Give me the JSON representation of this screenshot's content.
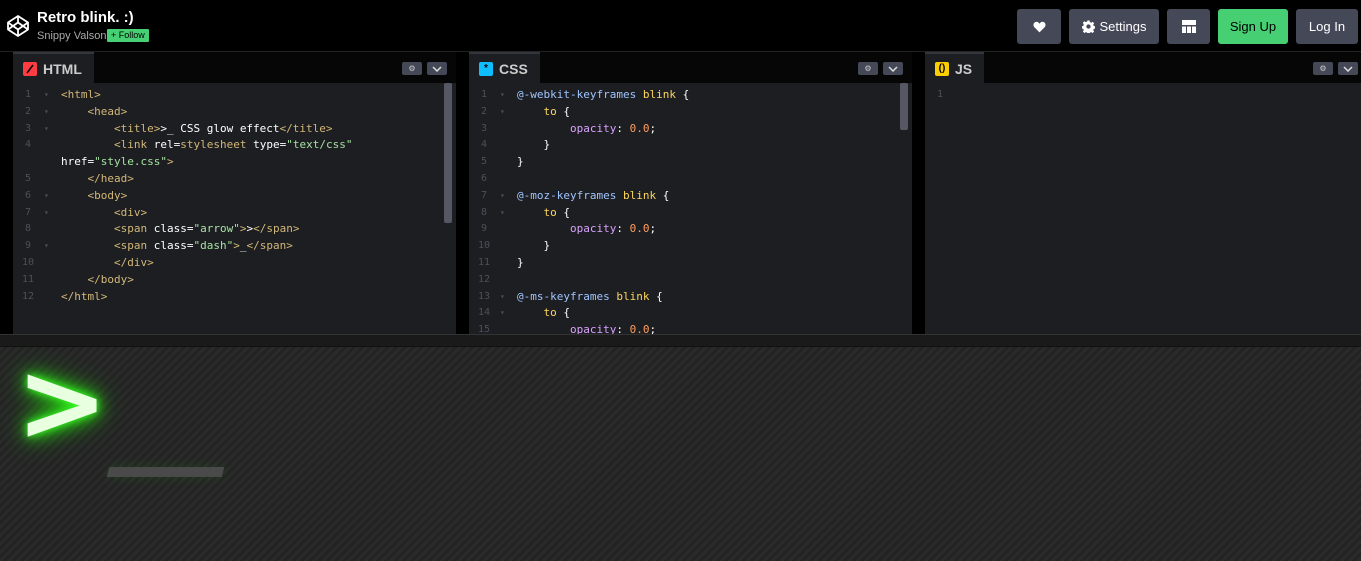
{
  "header": {
    "title": "Retro blink. :)",
    "author": "Snippy Valson",
    "follow_label": "+ Follow",
    "buttons": {
      "settings": "Settings",
      "signup": "Sign Up",
      "login": "Log In"
    }
  },
  "panes": {
    "html": {
      "label": "HTML",
      "icon": "html-icon",
      "color": "#ff3c41"
    },
    "css": {
      "label": "CSS",
      "icon": "css-icon",
      "color": "#0ebeff"
    },
    "js": {
      "label": "JS",
      "icon": "js-icon",
      "color": "#fcd000"
    }
  },
  "html_code": [
    {
      "n": "1",
      "fold": true,
      "parts": [
        [
          "tag",
          "<html>"
        ]
      ]
    },
    {
      "n": "2",
      "fold": true,
      "parts": [
        [
          "plain",
          "    "
        ],
        [
          "tag",
          "<head>"
        ]
      ]
    },
    {
      "n": "3",
      "fold": true,
      "parts": [
        [
          "plain",
          "        "
        ],
        [
          "tag",
          "<title>"
        ],
        [
          "plain",
          ">_ CSS glow effect"
        ],
        [
          "tag",
          "</title>"
        ]
      ]
    },
    {
      "n": "4",
      "fold": false,
      "parts": [
        [
          "plain",
          "        "
        ],
        [
          "tag",
          "<link "
        ],
        [
          "attr",
          "rel"
        ],
        [
          "plain",
          "="
        ],
        [
          "tag",
          "stylesheet "
        ],
        [
          "attr",
          "type"
        ],
        [
          "plain",
          "="
        ],
        [
          "str",
          "\"text/css\""
        ]
      ]
    },
    {
      "n": "",
      "fold": false,
      "parts": [
        [
          "attr",
          "href"
        ],
        [
          "plain",
          "="
        ],
        [
          "str",
          "\"style.css\""
        ],
        [
          "tag",
          ">"
        ]
      ]
    },
    {
      "n": "5",
      "fold": false,
      "parts": [
        [
          "plain",
          "    "
        ],
        [
          "tag",
          "</head>"
        ]
      ]
    },
    {
      "n": "6",
      "fold": true,
      "parts": [
        [
          "plain",
          "    "
        ],
        [
          "tag",
          "<body>"
        ]
      ]
    },
    {
      "n": "7",
      "fold": true,
      "parts": [
        [
          "plain",
          "        "
        ],
        [
          "tag",
          "<div>"
        ]
      ]
    },
    {
      "n": "8",
      "fold": false,
      "parts": [
        [
          "plain",
          "        "
        ],
        [
          "tag",
          "<span "
        ],
        [
          "attr",
          "class"
        ],
        [
          "plain",
          "="
        ],
        [
          "str",
          "\"arrow\""
        ],
        [
          "tag",
          ">"
        ],
        [
          "plain",
          ">"
        ],
        [
          "tag",
          "</span>"
        ]
      ]
    },
    {
      "n": "9",
      "fold": true,
      "parts": [
        [
          "plain",
          "        "
        ],
        [
          "tag",
          "<span "
        ],
        [
          "attr",
          "class"
        ],
        [
          "plain",
          "="
        ],
        [
          "str",
          "\"dash\""
        ],
        [
          "tag",
          ">"
        ],
        [
          "plain",
          "_"
        ],
        [
          "tag",
          "</span>"
        ]
      ]
    },
    {
      "n": "10",
      "fold": false,
      "parts": [
        [
          "plain",
          "        "
        ],
        [
          "tag",
          "</div>"
        ]
      ]
    },
    {
      "n": "11",
      "fold": false,
      "parts": [
        [
          "plain",
          "    "
        ],
        [
          "tag",
          "</body>"
        ]
      ]
    },
    {
      "n": "12",
      "fold": false,
      "parts": [
        [
          "tag",
          "</html>"
        ]
      ]
    }
  ],
  "css_code": [
    {
      "n": "1",
      "fold": true,
      "parts": [
        [
          "kw",
          "@-webkit-keyframes "
        ],
        [
          "sel",
          "blink"
        ],
        [
          "plain",
          " {"
        ]
      ]
    },
    {
      "n": "2",
      "fold": true,
      "parts": [
        [
          "plain",
          "    "
        ],
        [
          "sel",
          "to"
        ],
        [
          "plain",
          " {"
        ]
      ]
    },
    {
      "n": "3",
      "fold": false,
      "parts": [
        [
          "plain",
          "        "
        ],
        [
          "prop",
          "opacity"
        ],
        [
          "plain",
          ": "
        ],
        [
          "num",
          "0.0"
        ],
        [
          "plain",
          ";"
        ]
      ]
    },
    {
      "n": "4",
      "fold": false,
      "parts": [
        [
          "plain",
          "    }"
        ]
      ]
    },
    {
      "n": "5",
      "fold": false,
      "parts": [
        [
          "plain",
          "}"
        ]
      ]
    },
    {
      "n": "6",
      "fold": false,
      "parts": []
    },
    {
      "n": "7",
      "fold": true,
      "parts": [
        [
          "kw",
          "@-moz-keyframes "
        ],
        [
          "sel",
          "blink"
        ],
        [
          "plain",
          " {"
        ]
      ]
    },
    {
      "n": "8",
      "fold": true,
      "parts": [
        [
          "plain",
          "    "
        ],
        [
          "sel",
          "to"
        ],
        [
          "plain",
          " {"
        ]
      ]
    },
    {
      "n": "9",
      "fold": false,
      "parts": [
        [
          "plain",
          "        "
        ],
        [
          "prop",
          "opacity"
        ],
        [
          "plain",
          ": "
        ],
        [
          "num",
          "0.0"
        ],
        [
          "plain",
          ";"
        ]
      ]
    },
    {
      "n": "10",
      "fold": false,
      "parts": [
        [
          "plain",
          "    }"
        ]
      ]
    },
    {
      "n": "11",
      "fold": false,
      "parts": [
        [
          "plain",
          "}"
        ]
      ]
    },
    {
      "n": "12",
      "fold": false,
      "parts": []
    },
    {
      "n": "13",
      "fold": true,
      "parts": [
        [
          "kw",
          "@-ms-keyframes "
        ],
        [
          "sel",
          "blink"
        ],
        [
          "plain",
          " {"
        ]
      ]
    },
    {
      "n": "14",
      "fold": true,
      "parts": [
        [
          "plain",
          "    "
        ],
        [
          "sel",
          "to"
        ],
        [
          "plain",
          " {"
        ]
      ]
    },
    {
      "n": "15",
      "fold": false,
      "parts": [
        [
          "plain",
          "        "
        ],
        [
          "prop",
          "opacity"
        ],
        [
          "plain",
          ": "
        ],
        [
          "num",
          "0.0"
        ],
        [
          "plain",
          ";"
        ]
      ]
    }
  ],
  "js_code": [
    {
      "n": "1",
      "fold": false,
      "parts": []
    }
  ],
  "preview": {
    "arrow": ">",
    "dash": ""
  }
}
